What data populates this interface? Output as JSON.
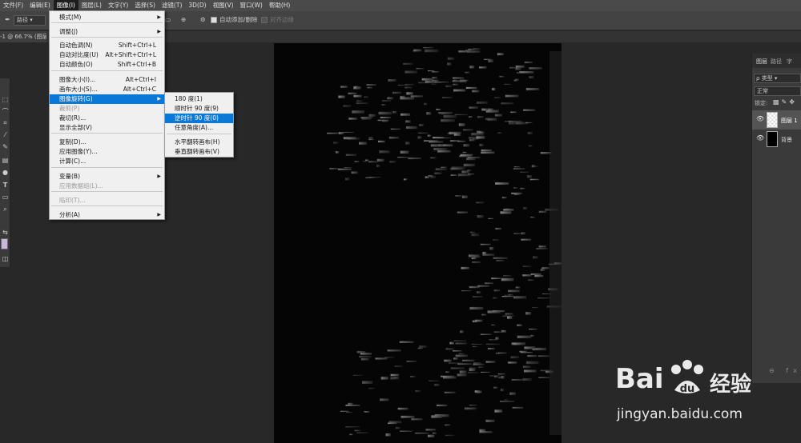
{
  "menubar": {
    "items": [
      "文件(F)",
      "编辑(E)",
      "图像(I)",
      "图层(L)",
      "文字(Y)",
      "选择(S)",
      "滤镜(T)",
      "3D(D)",
      "视图(V)",
      "窗口(W)",
      "帮助(H)"
    ]
  },
  "options": {
    "mode_select": "路径",
    "auto_add_delete": "自动添加/删除",
    "align_edges": "对齐边缘"
  },
  "document_tab": "-1 @ 66.7% (图层",
  "image_menu": {
    "items": [
      {
        "label": "模式(M)",
        "shortcut": "",
        "submenu": true,
        "disabled": false
      },
      {
        "label": "调整(J)",
        "shortcut": "",
        "submenu": true,
        "disabled": false
      },
      {
        "label": "自动色调(N)",
        "shortcut": "Shift+Ctrl+L",
        "submenu": false,
        "disabled": false
      },
      {
        "label": "自动对比度(U)",
        "shortcut": "Alt+Shift+Ctrl+L",
        "submenu": false,
        "disabled": false
      },
      {
        "label": "自动颜色(O)",
        "shortcut": "Shift+Ctrl+B",
        "submenu": false,
        "disabled": false
      },
      {
        "label": "图像大小(I)...",
        "shortcut": "Alt+Ctrl+I",
        "submenu": false,
        "disabled": false
      },
      {
        "label": "画布大小(S)...",
        "shortcut": "Alt+Ctrl+C",
        "submenu": false,
        "disabled": false
      },
      {
        "label": "图像旋转(G)",
        "shortcut": "",
        "submenu": true,
        "disabled": false,
        "highlighted": true
      },
      {
        "label": "裁剪(P)",
        "shortcut": "",
        "submenu": false,
        "disabled": true
      },
      {
        "label": "裁切(R)...",
        "shortcut": "",
        "submenu": false,
        "disabled": false
      },
      {
        "label": "显示全部(V)",
        "shortcut": "",
        "submenu": false,
        "disabled": false
      },
      {
        "label": "复制(D)...",
        "shortcut": "",
        "submenu": false,
        "disabled": false
      },
      {
        "label": "应用图像(Y)...",
        "shortcut": "",
        "submenu": false,
        "disabled": false
      },
      {
        "label": "计算(C)...",
        "shortcut": "",
        "submenu": false,
        "disabled": false
      },
      {
        "label": "变量(B)",
        "shortcut": "",
        "submenu": true,
        "disabled": false
      },
      {
        "label": "应用数据组(L)...",
        "shortcut": "",
        "submenu": false,
        "disabled": true
      },
      {
        "label": "陷印(T)...",
        "shortcut": "",
        "submenu": false,
        "disabled": true
      },
      {
        "label": "分析(A)",
        "shortcut": "",
        "submenu": true,
        "disabled": false
      }
    ]
  },
  "rotation_submenu": {
    "items": [
      {
        "label": "180 度(1)",
        "highlighted": false
      },
      {
        "label": "顺时针 90 度(9)",
        "highlighted": false
      },
      {
        "label": "逆时针 90 度(0)",
        "highlighted": true
      },
      {
        "label": "任意角度(A)...",
        "highlighted": false
      },
      {
        "label": "水平翻转画布(H)",
        "highlighted": false
      },
      {
        "label": "垂直翻转画布(V)",
        "highlighted": false
      }
    ]
  },
  "layers_panel": {
    "tabs": [
      "图层",
      "路径",
      "字"
    ],
    "filter_kind": "类型",
    "blend_mode": "正常",
    "lock_label": "锁定:",
    "layers": [
      {
        "name": "图层 1"
      },
      {
        "name": "背景"
      }
    ]
  },
  "watermark": {
    "brand": "Bai",
    "brand_suffix": "经验",
    "url": "jingyan.baidu.com"
  },
  "colors": {
    "highlight": "#0a78d7",
    "menubar": "#4a4a4a",
    "menu_bg": "#f0f0f0"
  }
}
